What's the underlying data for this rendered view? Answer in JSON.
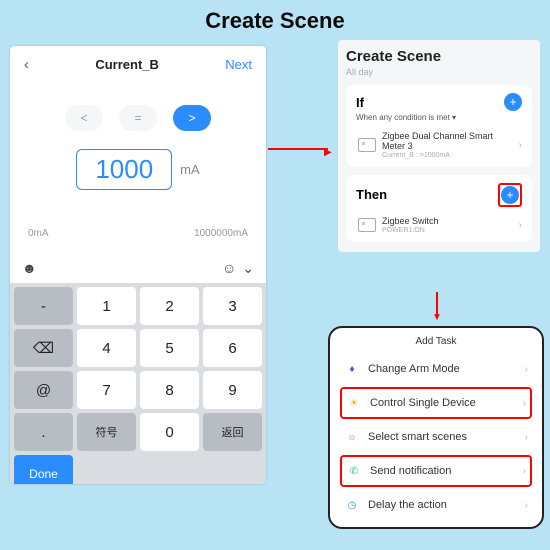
{
  "page_title": "Create Scene",
  "left": {
    "title": "Current_B",
    "next": "Next",
    "compare": {
      "lt": "<",
      "eq": "=",
      "gt": ">"
    },
    "value": "1000",
    "unit": "mA",
    "min": "0mA",
    "max": "1000000mA",
    "keys": [
      "-",
      "1",
      "2",
      "3",
      "",
      "4",
      "5",
      "6",
      "@",
      "7",
      "8",
      "9",
      ".",
      "符号",
      "0",
      "返回",
      "Done"
    ],
    "key_backspace": "⌫"
  },
  "right": {
    "title": "Create Scene",
    "subtitle": "All day",
    "if": {
      "label": "If",
      "sub": "When any condition is met",
      "device": "Zigbee Dual Channel Smart Meter 3",
      "detail": "Current_B : >1000mA"
    },
    "then": {
      "label": "Then",
      "device": "Zigbee Switch",
      "detail": "POWER1:ON"
    }
  },
  "bottom": {
    "title": "Add Task",
    "rows": [
      "Change Arm Mode",
      "Control Single Device",
      "Select smart scenes",
      "Send notification",
      "Delay the action"
    ]
  }
}
